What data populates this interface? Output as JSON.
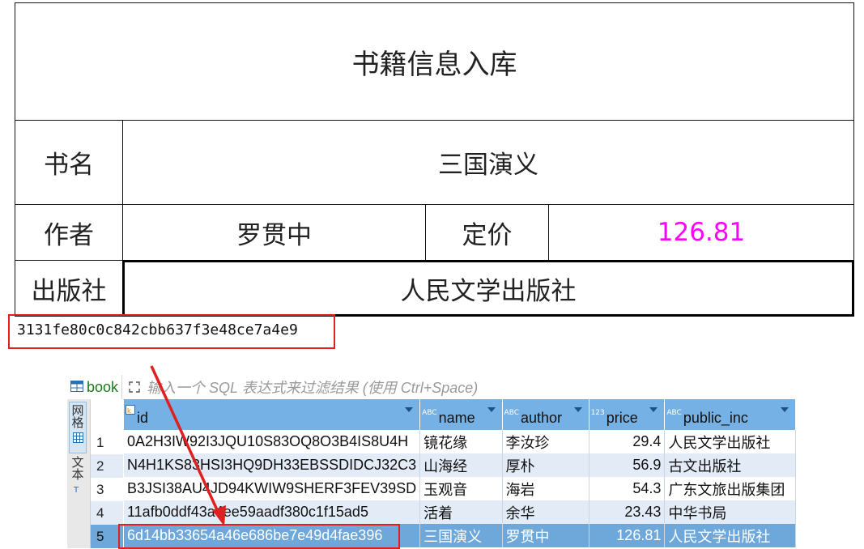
{
  "form": {
    "title": "书籍信息入库",
    "book_label": "书名",
    "book_value": "三国演义",
    "author_label": "作者",
    "author_value": "罗贯中",
    "price_label": "定价",
    "price_value": "126.81",
    "publisher_label": "出版社",
    "publisher_value": "人民文学出版社"
  },
  "hash": "3131fe80c0c842cbb637f3e48ce7a4e9",
  "grid": {
    "tab_label": "book",
    "filter_placeholder": "输入一个 SQL 表达式来过滤结果 (使用 Ctrl+Space)",
    "side_grid_label": "网格",
    "side_text_label": "文本",
    "columns": [
      {
        "name": "id",
        "type": "key"
      },
      {
        "name": "name",
        "type": "ABC"
      },
      {
        "name": "author",
        "type": "ABC"
      },
      {
        "name": "price",
        "type": "123"
      },
      {
        "name": "public_inc",
        "type": "ABC"
      }
    ],
    "rows": [
      {
        "num": "1",
        "id": "0A2H3IW92I3JQU10S83OQ8O3B4IS8U4H",
        "name": "镜花缘",
        "author": "李汝珍",
        "price": "29.4",
        "public_inc": "人民文学出版社"
      },
      {
        "num": "2",
        "id": "N4H1KS83HSI3HQ9DH33EBSSDIDCJ32C3",
        "name": "山海经",
        "author": "厚朴",
        "price": "56.9",
        "public_inc": "古文出版社"
      },
      {
        "num": "3",
        "id": "B3JSI38AU4JD94KWIW9SHERF3FEV39SD",
        "name": "玉观音",
        "author": "海岩",
        "price": "54.3",
        "public_inc": "广东文旅出版集团"
      },
      {
        "num": "4",
        "id": "11afb0ddf43a4ee59aadf380c1f15ad5",
        "name": "活着",
        "author": "余华",
        "price": "23.43",
        "public_inc": "中华书局"
      },
      {
        "num": "5",
        "id": "6d14bb33654a46e686be7e49d4fae396",
        "name": "三国演义",
        "author": "罗贯中",
        "price": "126.81",
        "public_inc": "人民文学出版社"
      }
    ],
    "selected_row": 5
  },
  "colors": {
    "price_text": "#ff00ff",
    "highlight_box": "#e02020",
    "header_bg": "#75b1e5",
    "selected_row_bg": "#6ea8da",
    "alt_row_bg": "#e3ecf6"
  }
}
